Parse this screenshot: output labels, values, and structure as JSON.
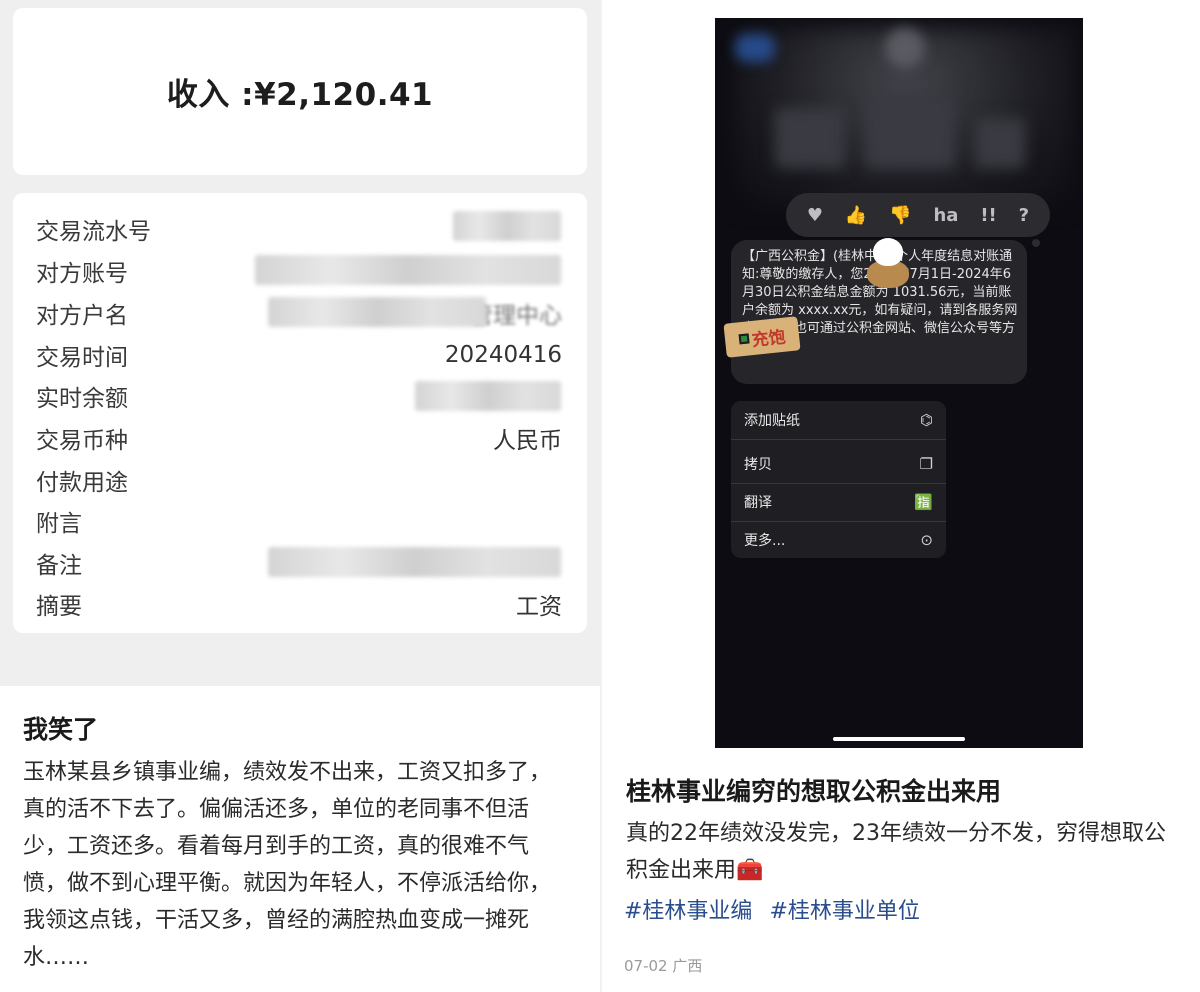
{
  "left": {
    "income_card": {
      "amount": "收入 :¥2,120.41"
    },
    "details": [
      {
        "label": "交易流水号",
        "value": ""
      },
      {
        "label": "对方账号",
        "value": ""
      },
      {
        "label": "对方户名",
        "value": "管理中心"
      },
      {
        "label": "交易时间",
        "value": "20240416"
      },
      {
        "label": "实时余额",
        "value": ""
      },
      {
        "label": "交易币种",
        "value": "人民币"
      },
      {
        "label": "付款用途",
        "value": ""
      },
      {
        "label": "附言",
        "value": ""
      },
      {
        "label": "备注",
        "value": ""
      },
      {
        "label": "摘要",
        "value": "工资"
      }
    ],
    "post": {
      "title": "我笑了",
      "body": "玉林某县乡镇事业编，绩效发不出来，工资又扣多了，真的活不下去了。偏偏活还多，单位的老同事不但活少，工资还多。看着每月到手的工资，真的很难不气愤，做不到心理平衡。就因为年轻人，不停派活给你，我领这点钱，干活又多，曾经的满腔热血变成一摊死水……"
    }
  },
  "right": {
    "phone": {
      "reactions": [
        "♥",
        "👍",
        "👎",
        "ha",
        "!!",
        "?"
      ],
      "message": "【广西公积金】(桂林中心)个人年度结息对账通知:尊敬的缴存人，您2023年7月1日-2024年6月30日公积金结息金额为 1031.56元，当前账户余额为 xxxx.xx元，如有疑问，请到各服务网点咨询，也可通过公积金网站、微信公众号等方式查询。",
      "sticker_text": "充饱",
      "menu": [
        {
          "label": "添加贴纸",
          "icon": "sticker-icon"
        },
        {
          "label": "拷贝",
          "icon": "copy-icon"
        },
        {
          "label": "翻译",
          "icon": "translate-icon"
        },
        {
          "label": "更多...",
          "icon": "more-icon"
        }
      ]
    },
    "post": {
      "title": "桂林事业编穷的想取公积金出来用",
      "body": "真的22年绩效没发完，23年绩效一分不发，穷得想取公积金出来用🧰",
      "tags": [
        "#桂林事业编",
        "#桂林事业单位"
      ],
      "meta": "07-02 广西"
    }
  }
}
